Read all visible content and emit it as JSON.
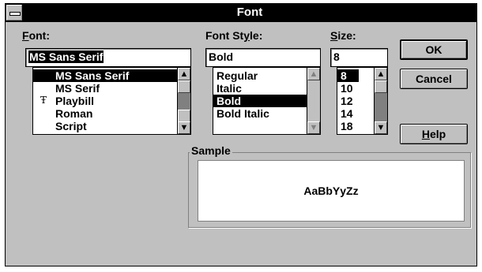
{
  "window": {
    "title": "Font"
  },
  "font": {
    "label_prefix": "F",
    "label_rest": "ont:",
    "value": "MS Sans Serif",
    "items": [
      "MS Sans Serif",
      "MS Serif",
      "Playbill",
      "Roman",
      "Script"
    ],
    "selected_index": 0,
    "truetype_item": "Playbill"
  },
  "style": {
    "label_prefix": "Font St",
    "label_u": "y",
    "label_rest": "le:",
    "value": "Bold",
    "items": [
      "Regular",
      "Italic",
      "Bold",
      "Bold Italic"
    ],
    "selected_index": 2
  },
  "size": {
    "label_u": "S",
    "label_rest": "ize:",
    "value": "8",
    "items": [
      "8",
      "10",
      "12",
      "14",
      "18"
    ],
    "selected_index": 0
  },
  "buttons": {
    "ok": "OK",
    "cancel": "Cancel",
    "help_u": "H",
    "help_rest": "elp"
  },
  "sample": {
    "label": "Sample",
    "text": "AaBbYyZz"
  },
  "icons": {
    "system_menu": "dash-icon",
    "truetype": "truetype-icon",
    "scroll_up": "arrow-up-icon",
    "scroll_down": "arrow-down-icon"
  }
}
